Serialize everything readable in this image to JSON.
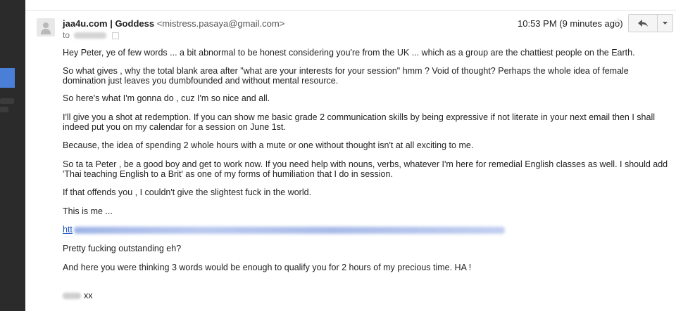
{
  "message": {
    "sender_name": "jaa4u.com | Goddess",
    "sender_email": "<mistress.pasaya@gmail.com>",
    "to_prefix": "to",
    "timestamp": "10:53 PM (9 minutes ago)",
    "star_glyph": "☆",
    "reply_icon": "reply-arrow-icon",
    "more_icon": "caret-down-icon",
    "body": {
      "p1": "Hey Peter, ye of few words ... a bit abnormal to be honest considering you're from the UK ... which as a group are the chattiest people on the Earth.",
      "p2": "So what gives , why the total blank area after \"what are your interests for your session\" hmm ?  Void of thought?  Perhaps the whole idea of female domination just leaves you dumbfounded and without mental resource.",
      "p3": "So here's what I'm gonna do , cuz I'm so nice and all.",
      "p4": "I'll give you a shot at redemption.  If you can show me basic grade 2 communication skills by being expressive if not literate in your next email then I shall indeed put you on my calendar for a session on June 1st.",
      "p5": "Because, the idea of spending 2 whole hours with a mute or one without thought isn't at all exciting to me.",
      "p6": "So ta ta Peter , be a good boy and get to work now.  If you need help with nouns, verbs, whatever I'm here for remedial English classes as well.  I should add 'Thai teaching English to a Brit' as one of my forms of humiliation that I do in session.",
      "p7": "If that offends you , I couldn't give the slightest fuck in the world.",
      "p8": "This is me ...",
      "link_prefix": "htt",
      "p10": "Pretty fucking outstanding eh?",
      "p11": "And here you were thinking 3 words would be enough to qualify you for 2 hours of my precious time.  HA !",
      "signoff": "xx"
    }
  },
  "colors": {
    "sidebar": "#2b2b2b",
    "sidebar_accent": "#4a7fd8",
    "link": "#1a52c5"
  }
}
